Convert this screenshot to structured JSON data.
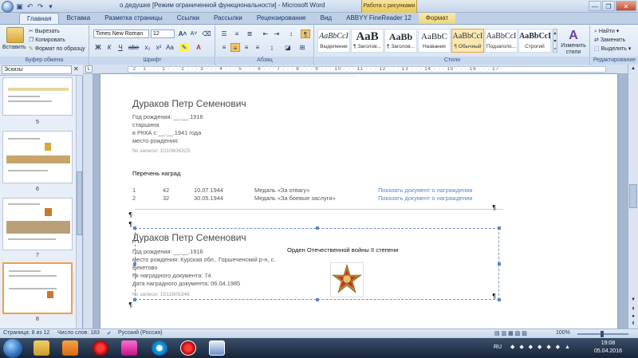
{
  "window": {
    "title": "о дедушке [Режим ограниченной функциональности] - Microsoft Word",
    "context_tab": "Работа с рисунками",
    "min": "—",
    "max": "❐",
    "close": "✕"
  },
  "tabs": [
    "Главная",
    "Вставка",
    "Разметка страницы",
    "Ссылки",
    "Рассылки",
    "Рецензирование",
    "Вид",
    "ABBYY FineReader 12",
    "Формат"
  ],
  "ribbon": {
    "clipboard": {
      "paste": "Вставить",
      "cut": "Вырезать",
      "copy": "Копировать",
      "format_painter": "Формат по образцу",
      "label": "Буфер обмена"
    },
    "font": {
      "name": "Times New Roman",
      "size": "12",
      "bold": "Ж",
      "italic": "К",
      "underline": "Ч",
      "label": "Шрифт"
    },
    "paragraph": {
      "label": "Абзац"
    },
    "styles": {
      "items": [
        {
          "sample": "AaBbCcI",
          "name": "Выделение"
        },
        {
          "sample": "AaB",
          "name": "¶ Заголов..."
        },
        {
          "sample": "AaBb",
          "name": "¶ Заголов..."
        },
        {
          "sample": "AaBbC",
          "name": "Название"
        },
        {
          "sample": "AaBbCcI",
          "name": "¶ Обычный"
        },
        {
          "sample": "AaBbCcI",
          "name": "Подзаголо..."
        },
        {
          "sample": "AaBbCcI",
          "name": "Строгий"
        },
        {
          "sample": "AaBbCcI",
          "name": "¶ Заголов..."
        }
      ],
      "change": "Изменить стили",
      "label": "Стили"
    },
    "editing": {
      "find": "Найти",
      "replace": "Заменить",
      "select": "Выделить",
      "label": "Редактирование"
    }
  },
  "pane": {
    "view": "Эскизы",
    "thumbs": [
      "5",
      "6",
      "7",
      "8"
    ]
  },
  "ruler_text": "· 2 · 1 · · · 1 · · · 2 · · · 3 · · · 4 · · · 5 · · · 6 · · · 7 · · · 8 · · · 9 · · · 10 · · · 11 · · · 12 · · · 13 · · · 14 · · · 15 · · · 16 · · · 17 ·",
  "doc": {
    "record1": {
      "name": "Дураков Петр Семенович",
      "birth": "Год рождения: __.__.1916",
      "rank": "старшина",
      "rkka": "в РККА с __.__.1941 года",
      "birthplace": "место рождения:",
      "record_no": "№ записи: 1010606325"
    },
    "awards_title": "Перечень наград",
    "awards": [
      {
        "n": "1",
        "num": "42",
        "date": "10.07.1944",
        "medal": "Медаль «За отвагу»",
        "link": "Показать документ о награждении"
      },
      {
        "n": "2",
        "num": "32",
        "date": "30.05.1944",
        "medal": "Медаль «За боевые заслуги»",
        "link": "Показать документ о награждении"
      }
    ],
    "record2": {
      "name": "Дураков Петр Семенович",
      "birth": "Год рождения: __.__.1916",
      "birthplace_1": "место рождения: Курская обл., Горшеченский р-н, с.",
      "birthplace_2": "Бекетово",
      "doc_no": "№ наградного документа: 74",
      "doc_date": "дата наградного документа: 06.04.1985",
      "record_no": "№ записи: 1511605346",
      "order": "Орден Отечественной войны II степени"
    }
  },
  "status": {
    "page": "Страница: 8 из 12",
    "words": "Число слов: 183",
    "lang": "Русский (Россия)",
    "zoom": "100%"
  },
  "taskbar": {
    "lang": "RU",
    "time": "19:08",
    "date": "05.04.2016"
  }
}
